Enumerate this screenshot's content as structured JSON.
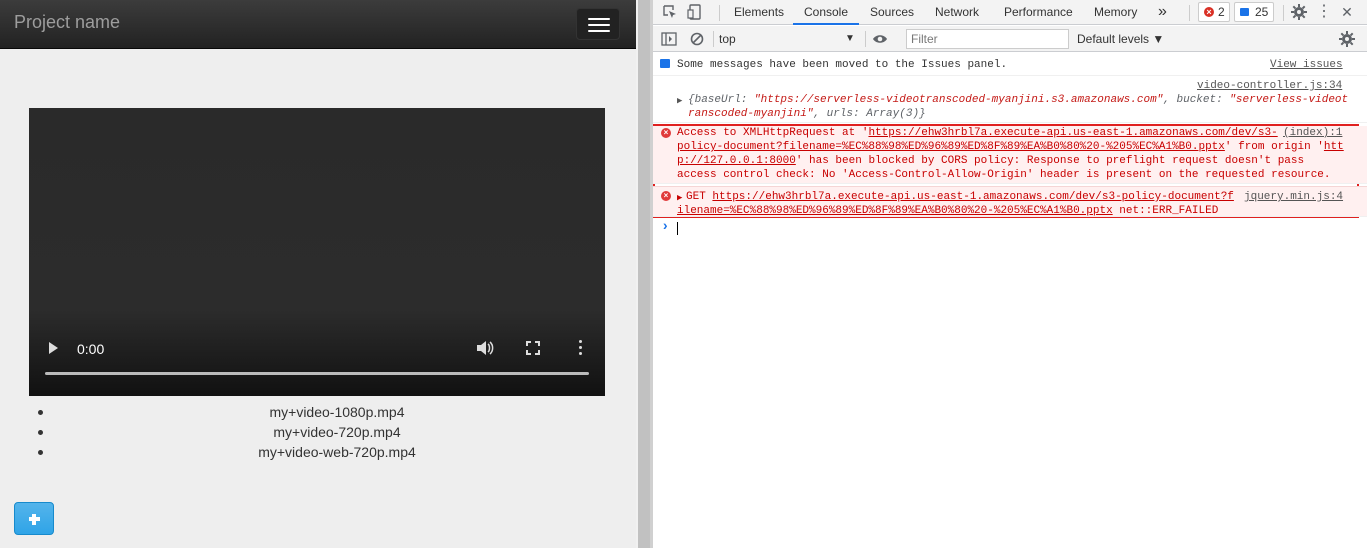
{
  "page": {
    "brand": "Project name",
    "video": {
      "time": "0:00"
    },
    "files": [
      "my+video-1080p.mp4",
      "my+video-720p.mp4",
      "my+video-web-720p.mp4"
    ],
    "add_button_icon": "plus-icon"
  },
  "devtools": {
    "tabs": [
      "Elements",
      "Console",
      "Sources",
      "Network",
      "Performance",
      "Memory"
    ],
    "active_tab": "Console",
    "more_tabs": "»",
    "error_count": "2",
    "issue_count": "25",
    "context": "top",
    "filter_placeholder": "Filter",
    "levels": "Default levels ▼",
    "colors": {
      "error": "#c80000",
      "accent": "#1a73e8",
      "highlight_box": "#e0201f"
    },
    "messages": {
      "issues_note": "Some messages have been moved to the Issues panel.",
      "view_issues": "View issues",
      "obj_source": "video-controller.js:34",
      "obj_line1_key1": "{baseUrl: ",
      "obj_line1_val1": "\"https://serverless-videotranscoded-myanjini.s3.amazonaws.com\"",
      "obj_line1_key2": ", bucket: ",
      "obj_line1_val2": "\"serverless-videot",
      "obj_line2_val2": "ranscoded-myanjini\"",
      "obj_line2_rest": ", urls: Array(3)}",
      "err1_source": "(index):1",
      "err1_pre": "Access to XMLHttpRequest at '",
      "err1_url1": "https://ehw3hrbl7a.execute-api.us-east-1.amazonaws.com/dev/s3-",
      "err1_url2": "policy-document?filename=%EC%88%98%ED%96%89%ED%8F%89%EA%B0%80%20-%205%EC%A1%B0.pptx",
      "err1_mid": "' from origin '",
      "err1_origin1": "htt",
      "err1_origin2": "p://127.0.0.1:8000",
      "err1_line3_rest": "' has been blocked by CORS policy: Response to preflight request doesn't pass",
      "err1_line4": "access control check: No 'Access-Control-Allow-Origin' header is present on the requested resource.",
      "err2_source": "jquery.min.js:4",
      "err2_method": "GET ",
      "err2_url1": "https://ehw3hrbl7a.execute-api.us-east-1.amazonaws.com/dev/s3-policy-document?f",
      "err2_url2": "ilename=%EC%88%98%ED%96%89%ED%8F%89%EA%B0%80%20-%205%EC%A1%B0.pptx",
      "err2_status": " net::ERR_FAILED",
      "prompt": "›"
    }
  }
}
